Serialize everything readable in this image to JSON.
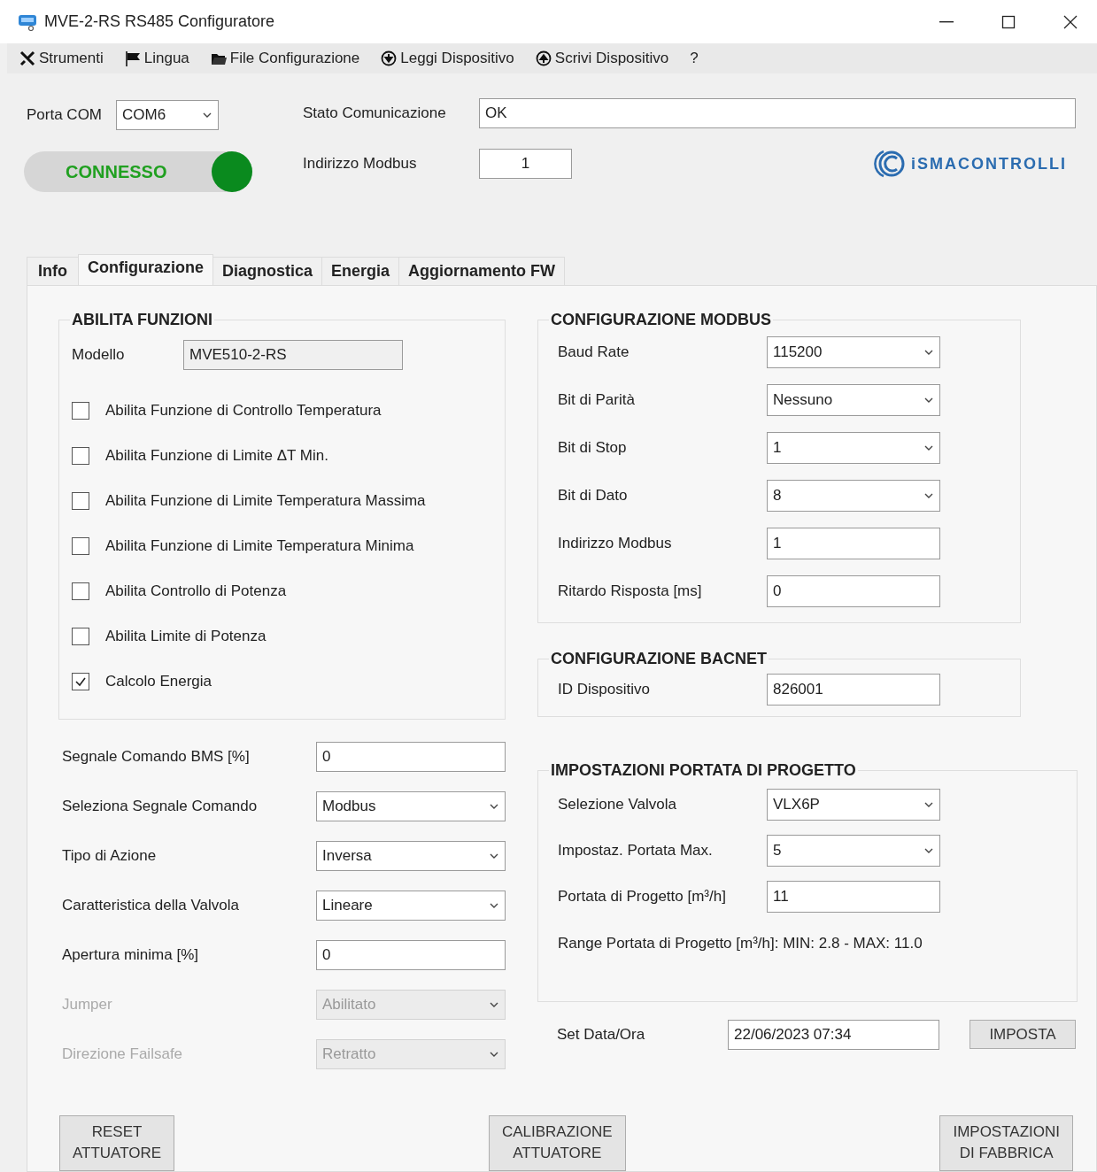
{
  "window": {
    "title": "MVE-2-RS RS485 Configuratore"
  },
  "menu": [
    {
      "label": "Strumenti",
      "kind": "tools"
    },
    {
      "label": "Lingua",
      "kind": "flag"
    },
    {
      "label": "File Configurazione",
      "kind": "folder"
    },
    {
      "label": "Leggi Dispositivo",
      "kind": "read"
    },
    {
      "label": "Scrivi Dispositivo",
      "kind": "write"
    },
    {
      "label": "?",
      "kind": "plain"
    }
  ],
  "connection": {
    "port_label": "Porta COM",
    "port_value": "COM6",
    "status_label": "Stato Comunicazione",
    "status_value": "OK",
    "address_label": "Indirizzo Modbus",
    "address_value": "1",
    "indicator_label": "CONNESSO",
    "connected": true
  },
  "logo": {
    "text": "iSMACONTROLLI"
  },
  "tabs": [
    {
      "label": "Info",
      "selected": false
    },
    {
      "label": "Configurazione",
      "selected": true
    },
    {
      "label": "Diagnostica",
      "selected": false
    },
    {
      "label": "Energia",
      "selected": false
    },
    {
      "label": "Aggiornamento FW",
      "selected": false
    }
  ],
  "features": {
    "title": "ABILITA FUNZIONI",
    "model_label": "Modello",
    "model_value": "MVE510-2-RS",
    "checkboxes": [
      {
        "label": "Abilita Funzione di Controllo Temperatura",
        "checked": false
      },
      {
        "label": "Abilita Funzione di Limite ΔT Min.",
        "checked": false
      },
      {
        "label": "Abilita Funzione di Limite Temperatura Massima",
        "checked": false
      },
      {
        "label": "Abilita Funzione di Limite Temperatura Minima",
        "checked": false
      },
      {
        "label": "Abilita Controllo di Potenza",
        "checked": false
      },
      {
        "label": "Abilita Limite di Potenza",
        "checked": false
      },
      {
        "label": "Calcolo Energia",
        "checked": true
      }
    ]
  },
  "command_fields": [
    {
      "label": "Segnale Comando BMS [%]",
      "kind": "input",
      "value": "0",
      "disabled": false
    },
    {
      "label": "Seleziona Segnale Comando",
      "kind": "select",
      "value": "Modbus",
      "disabled": false
    },
    {
      "label": "Tipo di Azione",
      "kind": "select",
      "value": "Inversa",
      "disabled": false
    },
    {
      "label": "Caratteristica della Valvola",
      "kind": "select",
      "value": "Lineare",
      "disabled": false
    },
    {
      "label": "Apertura minima [%]",
      "kind": "input",
      "value": "0",
      "disabled": false
    },
    {
      "label": "Jumper",
      "kind": "select",
      "value": "Abilitato",
      "disabled": true
    },
    {
      "label": "Direzione Failsafe",
      "kind": "select",
      "value": "Retratto",
      "disabled": true
    }
  ],
  "modbus": {
    "title": "CONFIGURAZIONE MODBUS",
    "fields": [
      {
        "label": "Baud Rate",
        "kind": "select",
        "value": "115200"
      },
      {
        "label": "Bit di Parità",
        "kind": "select",
        "value": "Nessuno"
      },
      {
        "label": "Bit di Stop",
        "kind": "select",
        "value": "1"
      },
      {
        "label": "Bit di Dato",
        "kind": "select",
        "value": "8"
      },
      {
        "label": "Indirizzo Modbus",
        "kind": "input",
        "value": "1"
      },
      {
        "label": "Ritardo Risposta [ms]",
        "kind": "input",
        "value": "0"
      }
    ]
  },
  "bacnet": {
    "title": "CONFIGURAZIONE BACNET",
    "fields": [
      {
        "label": "ID Dispositivo",
        "kind": "input",
        "value": "826001"
      }
    ]
  },
  "design_flow": {
    "title": "IMPOSTAZIONI PORTATA DI PROGETTO",
    "fields": [
      {
        "label": "Selezione Valvola",
        "kind": "select",
        "value": "VLX6P"
      },
      {
        "label": "Impostaz. Portata Max.",
        "kind": "select",
        "value": "5"
      },
      {
        "label": "Portata di Progetto [m³/h]",
        "kind": "input",
        "value": "11"
      }
    ],
    "range_note": "Range Portata di Progetto [m³/h]: MIN: 2.8 - MAX: 11.0"
  },
  "datetime": {
    "label": "Set Data/Ora",
    "value": "22/06/2023 07:34",
    "button": "IMPOSTA"
  },
  "buttons": [
    "RESET\nATTUATORE",
    "CALIBRAZIONE\nATTUATORE",
    "IMPOSTAZIONI\nDI FABBRICA"
  ]
}
